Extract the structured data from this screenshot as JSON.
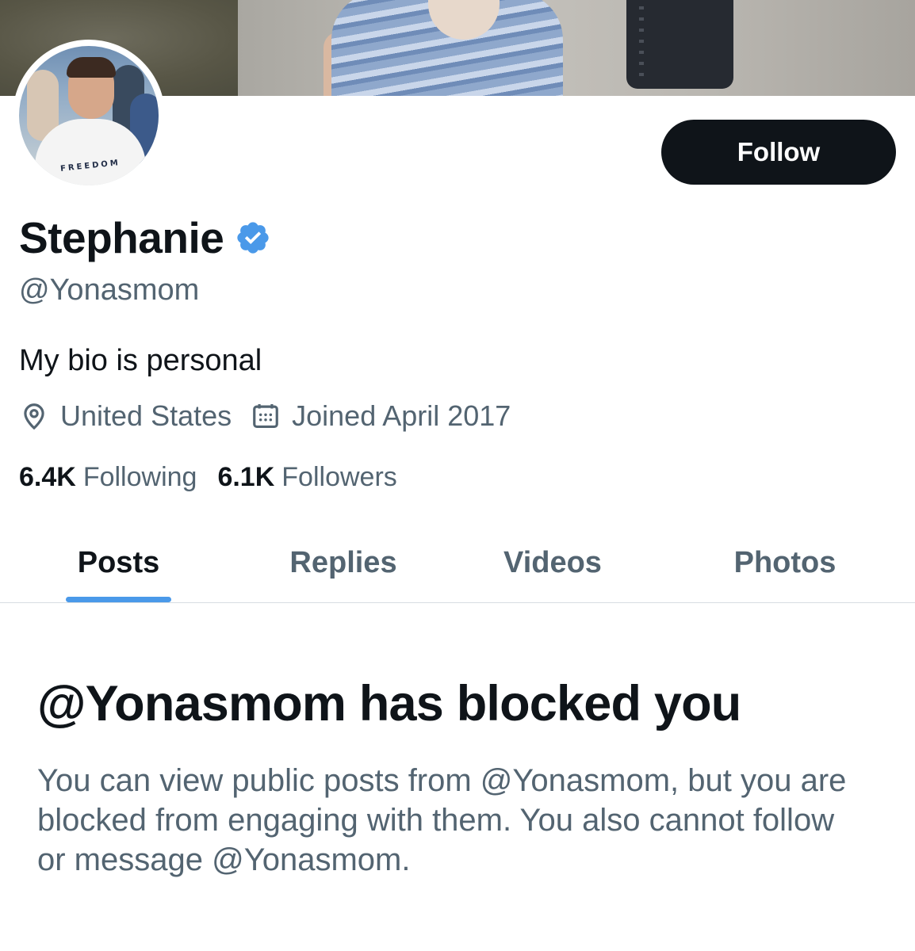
{
  "profile": {
    "display_name": "Stephanie",
    "verified": true,
    "handle": "@Yonasmom",
    "bio": "My bio is personal",
    "location": "United States",
    "joined": "Joined April 2017",
    "avatar_shirt_text": "FREEDOM"
  },
  "actions": {
    "follow_label": "Follow"
  },
  "stats": {
    "following_count": "6.4K",
    "following_label": "Following",
    "followers_count": "6.1K",
    "followers_label": "Followers"
  },
  "tabs": [
    {
      "label": "Posts",
      "active": true
    },
    {
      "label": "Replies",
      "active": false
    },
    {
      "label": "Videos",
      "active": false
    },
    {
      "label": "Photos",
      "active": false
    }
  ],
  "blocked": {
    "title": "@Yonasmom has blocked you",
    "message": "You can view public posts from @Yonasmom, but you are blocked from engaging with them. You also cannot follow or message @Yonasmom."
  },
  "icons": {
    "verified": "verified-badge-icon",
    "location": "location-pin-icon",
    "calendar": "calendar-icon"
  },
  "colors": {
    "verified_blue": "#4a99e9",
    "tab_indicator": "#4a99e9",
    "follow_button_bg": "#0f1419",
    "secondary_text": "#536471"
  }
}
